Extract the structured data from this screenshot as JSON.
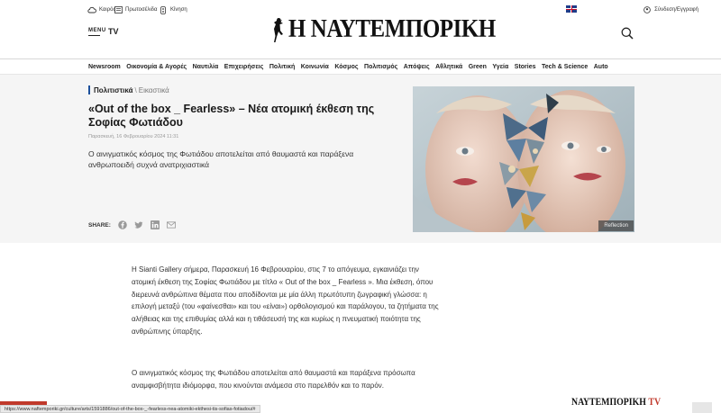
{
  "header": {
    "weather_label": "Καιρός",
    "frontpages_label": "Πρωτοσέλιδα",
    "traffic_label": "Κίνηση",
    "login_label": "Σύνδεση/Εγγραφή",
    "menu_label": "MENU",
    "tv_label": "TV",
    "logo_text": "Η ΝΑΥΤΕΜΠΟΡΙΚΗ"
  },
  "nav": {
    "items": [
      {
        "label": "Newsroom"
      },
      {
        "label": "Οικονομία & Αγορές"
      },
      {
        "label": "Ναυτιλία"
      },
      {
        "label": "Επιχειρήσεις"
      },
      {
        "label": "Πολιτική"
      },
      {
        "label": "Κοινωνία"
      },
      {
        "label": "Κόσμος"
      },
      {
        "label": "Πολιτισμός"
      },
      {
        "label": "Απόψεις"
      },
      {
        "label": "Αθλητικά"
      },
      {
        "label": "Green"
      },
      {
        "label": "Υγεία"
      },
      {
        "label": "Stories"
      },
      {
        "label": "Tech & Science"
      },
      {
        "label": "Auto"
      }
    ]
  },
  "article": {
    "category": "Πολιτιστικά",
    "subcategory": "Εικαστικά",
    "title": "«Out of the box _ Fearless» – Νέα ατομική έκθεση της Σοφίας Φωτιάδου",
    "date": "Παρασκευή, 16 Φεβρουαρίου 2024 11:31",
    "lead": "Ο αινιγματικός κόσμος της Φωτιάδου αποτελείται από θαυμαστά και παράξενα ανθρωποειδή συχνά ανατριχιαστικά",
    "share_label": "SHARE:",
    "image_caption": "Reflection",
    "paragraph1": "Η Sianti Gallery σήμερα, Παρασκευή 16 Φεβρουαρίου, στις 7 το απόγευμα, εγκαινιάζει την ατομική έκθεση της Σοφίας Φωτιάδου με τίτλο « Out of the box _ Fearless ». Μια έκθεση, όπου διερευνά ανθρώπινα θέματα που αποδίδονται με μία άλλη πρωτότυπη ζωγραφική γλώσσα: η επιλογή μεταξύ (του «φαίνεσθαι» και του «είναι») ορθολογισμού και παράλογου, τα ζητήματα της αλήθειας και της επιθυμίας αλλά και η τιθάσευσή της και κυρίως η πνευματική ποιότητα της ανθρώπινης ύπαρξης.",
    "paragraph2": "Ο αινιγματικός κόσμος της Φωτιάδου αποτελείται από θαυμαστά και παράξενα πρόσωπα αναμφισβήτητα ιδιόμορφα, που κινούνται ανάμεσα στο παρελθόν και το παρόν."
  },
  "status_bar": {
    "url": "https://www.naftemporiki.gr/culture/arts/1591886/out-of-the-box-_-fearless-nea-atomiki-ekthesi-tis-sofias-fotiadou/#"
  },
  "ad": {
    "brand": "ΝΑΥΤΕΜΠΟΡΙΚΗ",
    "suffix": "TV"
  },
  "colors": {
    "accent": "#1c4f9c",
    "hero_bg": "#f5f5f5",
    "tv_red": "#c0392b"
  }
}
